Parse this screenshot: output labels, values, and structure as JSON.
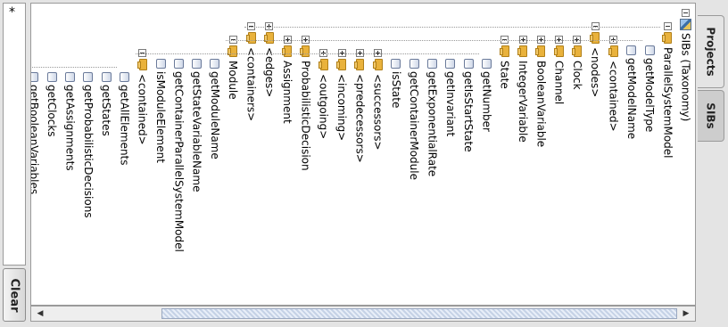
{
  "filter": {
    "value": "*"
  },
  "clear_button": {
    "label": "Clear"
  },
  "tabs": [
    {
      "label": "Projects"
    },
    {
      "label": "SIBs"
    }
  ],
  "tree": {
    "nodes": [
      {
        "label": "SIBs (Taxonomy)",
        "icon": "sib-icon",
        "expander": "minus",
        "level": 0
      },
      {
        "label": "ParallelSystemModel",
        "icon": "folder-icon",
        "expander": "minus",
        "level": 1
      },
      {
        "label": "getModelType",
        "icon": "leaf-icon",
        "expander": "",
        "level": 2
      },
      {
        "label": "getModelName",
        "icon": "leaf-icon",
        "expander": "",
        "level": 2
      },
      {
        "label": "<contained>",
        "icon": "folder-icon",
        "expander": "plus",
        "level": 2
      },
      {
        "label": "<nodes>",
        "icon": "folder-icon",
        "expander": "minus",
        "level": 1
      },
      {
        "label": "Clock",
        "icon": "folder-icon",
        "expander": "plus",
        "level": 2
      },
      {
        "label": "Channel",
        "icon": "folder-icon",
        "expander": "plus",
        "level": 2
      },
      {
        "label": "BooleanVariable",
        "icon": "folder-icon",
        "expander": "plus",
        "level": 2
      },
      {
        "label": "IntegerVariable",
        "icon": "folder-icon",
        "expander": "plus",
        "level": 2
      },
      {
        "label": "State",
        "icon": "folder-icon",
        "expander": "minus",
        "level": 2
      },
      {
        "label": "getNumber",
        "icon": "leaf-icon",
        "expander": "",
        "level": 3
      },
      {
        "label": "getIsStartState",
        "icon": "leaf-icon",
        "expander": "",
        "level": 3
      },
      {
        "label": "getInvariant",
        "icon": "leaf-icon",
        "expander": "",
        "level": 3
      },
      {
        "label": "getExponentialRate",
        "icon": "leaf-icon",
        "expander": "",
        "level": 3
      },
      {
        "label": "getContainerModule",
        "icon": "leaf-icon",
        "expander": "",
        "level": 3
      },
      {
        "label": "isState",
        "icon": "leaf-icon",
        "expander": "",
        "level": 3
      },
      {
        "label": "<successors>",
        "icon": "folder-icon",
        "expander": "plus",
        "level": 3
      },
      {
        "label": "<predecessors>",
        "icon": "folder-icon",
        "expander": "plus",
        "level": 3
      },
      {
        "label": "<incoming>",
        "icon": "folder-icon",
        "expander": "plus",
        "level": 3
      },
      {
        "label": "<outgoing>",
        "icon": "folder-icon",
        "expander": "plus",
        "level": 3
      },
      {
        "label": "ProbabilisticDecision",
        "icon": "folder-icon",
        "expander": "plus",
        "level": 2
      },
      {
        "label": "Assignment",
        "icon": "folder-icon",
        "expander": "plus",
        "level": 2
      },
      {
        "label": "<edges>",
        "icon": "folder-icon",
        "expander": "plus",
        "level": 1
      },
      {
        "label": "<containers>",
        "icon": "folder-icon",
        "expander": "minus",
        "level": 1
      },
      {
        "label": "Module",
        "icon": "folder-icon",
        "expander": "minus",
        "level": 2
      },
      {
        "label": "getModuleName",
        "icon": "leaf-icon",
        "expander": "",
        "level": 3
      },
      {
        "label": "getStateVariableName",
        "icon": "leaf-icon",
        "expander": "",
        "level": 3
      },
      {
        "label": "getContainerParallelSystemModel",
        "icon": "leaf-icon",
        "expander": "",
        "level": 3
      },
      {
        "label": "isModuleElement",
        "icon": "leaf-icon",
        "expander": "",
        "level": 3
      },
      {
        "label": "<contained>",
        "icon": "folder-icon",
        "expander": "minus",
        "level": 3
      },
      {
        "label": "getAllElements",
        "icon": "leaf-icon",
        "expander": "",
        "level": 4
      },
      {
        "label": "getStates",
        "icon": "leaf-icon",
        "expander": "",
        "level": 4
      },
      {
        "label": "getProbabilisticDecisions",
        "icon": "leaf-icon",
        "expander": "",
        "level": 4
      },
      {
        "label": "getAssignments",
        "icon": "leaf-icon",
        "expander": "",
        "level": 4
      },
      {
        "label": "getClocks",
        "icon": "leaf-icon",
        "expander": "",
        "level": 4
      },
      {
        "label": "getBooleanVariables",
        "icon": "leaf-icon",
        "expander": "",
        "level": 4
      }
    ]
  }
}
